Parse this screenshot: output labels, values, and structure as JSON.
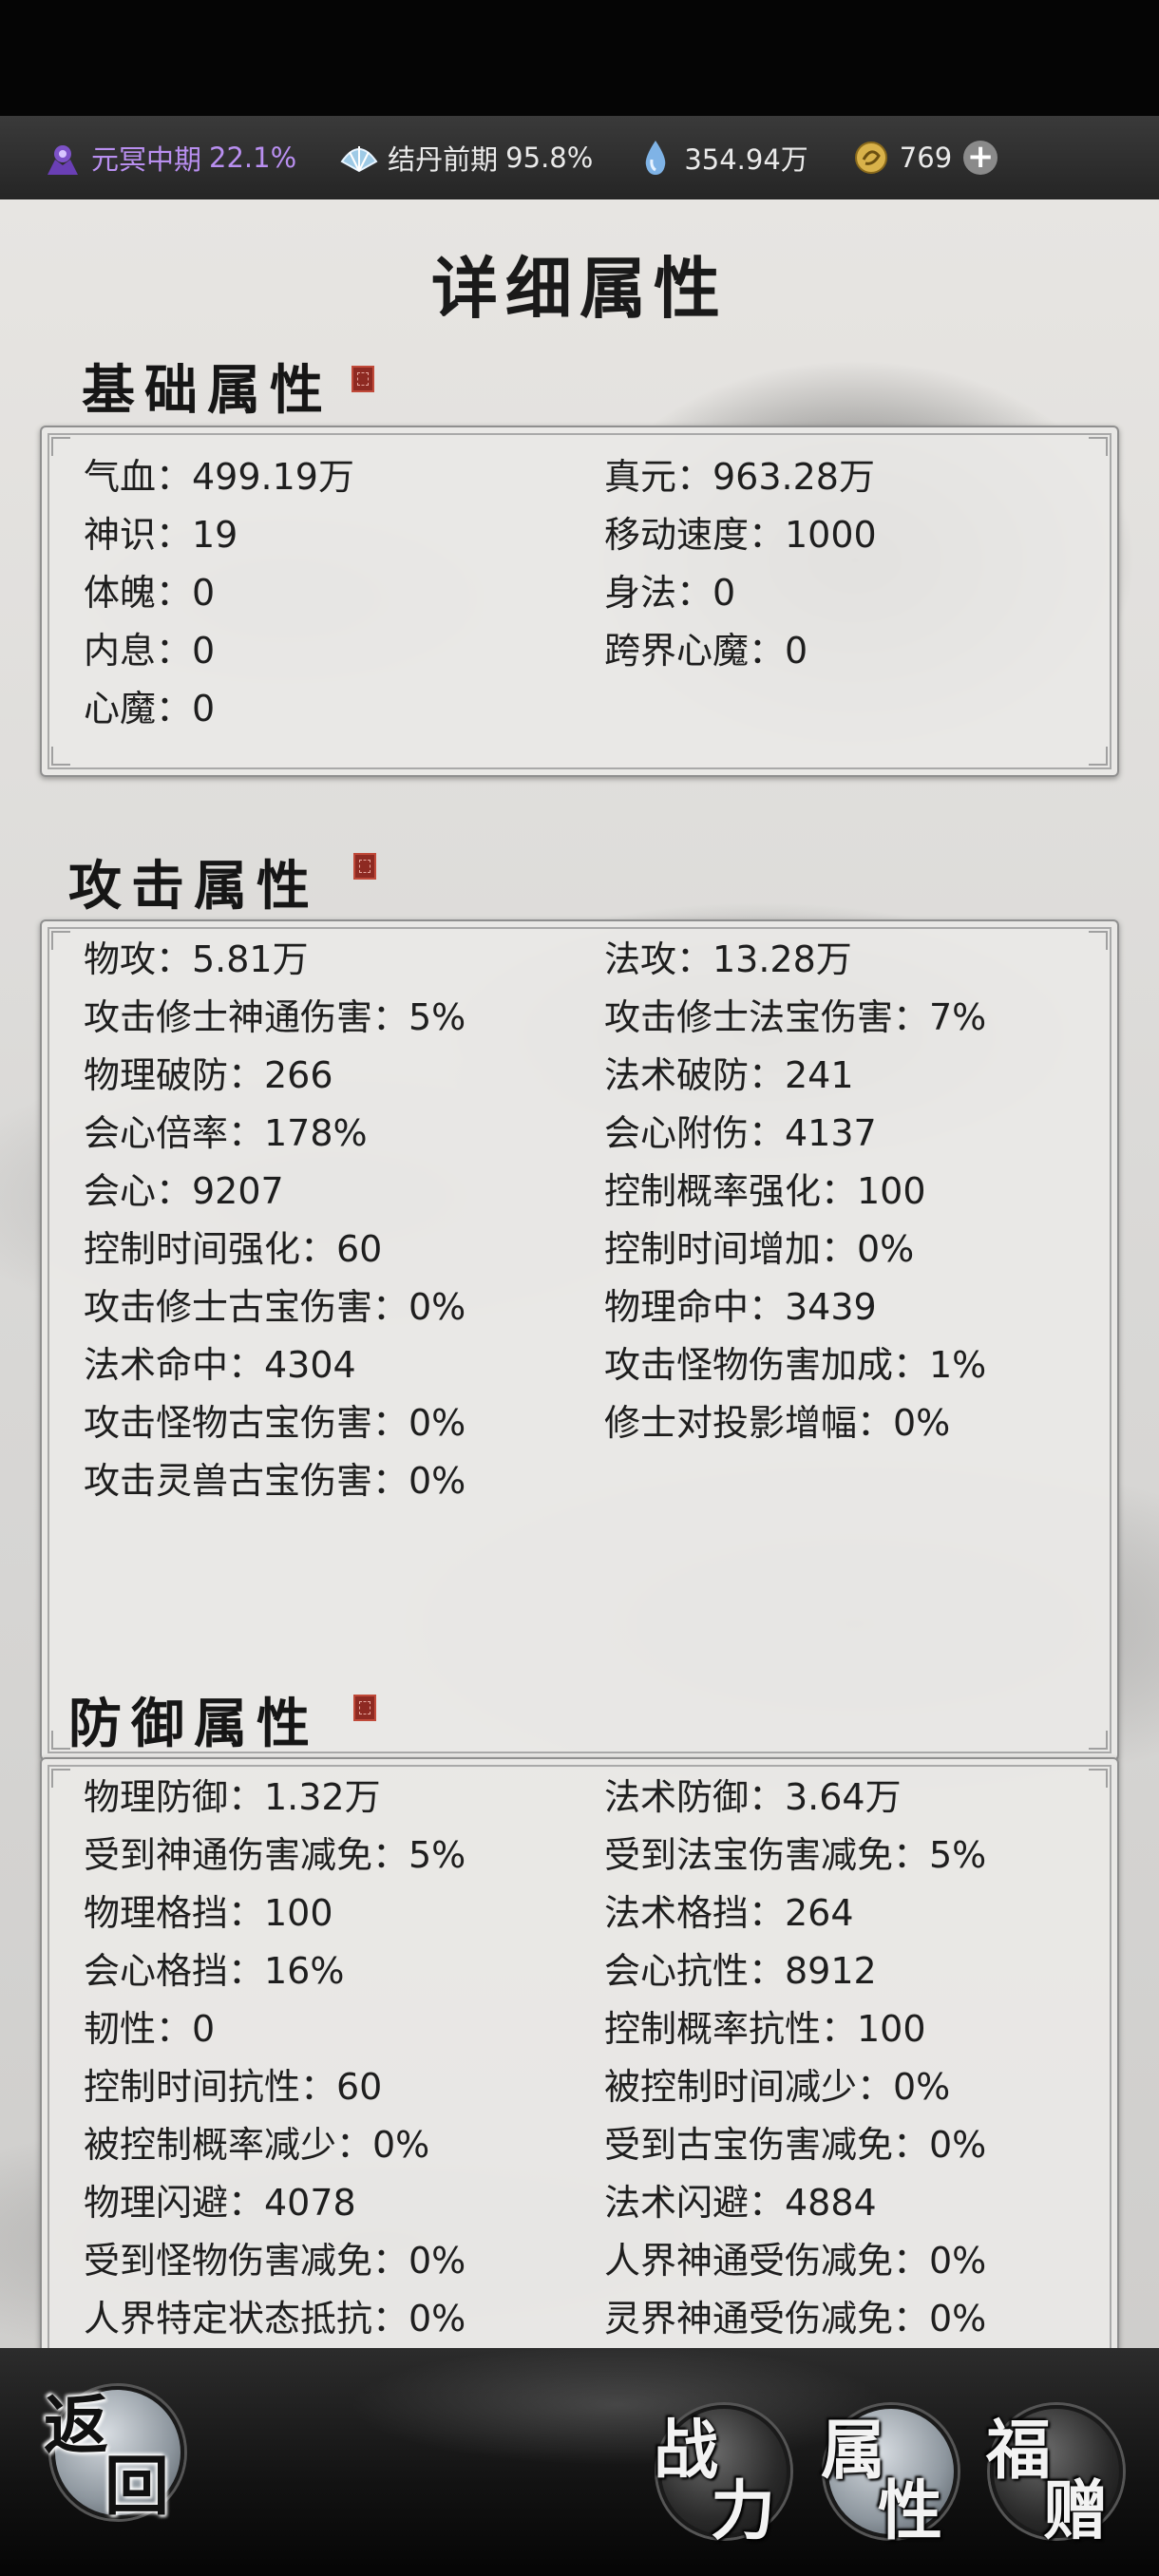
{
  "resources": {
    "realm": {
      "name": "元冥中期",
      "percent": "22.1%",
      "icon": "demon-realm-icon"
    },
    "core": {
      "name": "结丹前期",
      "percent": "95.8%",
      "icon": "fan-icon"
    },
    "spirit_water": {
      "amount": "354.94万",
      "icon": "water-drop-icon"
    },
    "coins": {
      "amount": "769",
      "icon": "coin-icon"
    },
    "add_label": "+"
  },
  "page_title": "详细属性",
  "sections": {
    "basic": {
      "title": "基础属性",
      "rows": [
        [
          "气血：499.19万",
          "真元：963.28万"
        ],
        [
          "神识：19",
          "移动速度：1000"
        ],
        [
          "体魄：0",
          "身法：0"
        ],
        [
          "内息：0",
          "跨界心魔：0"
        ],
        [
          "心魔：0",
          ""
        ]
      ]
    },
    "attack": {
      "title": "攻击属性",
      "rows": [
        [
          "物攻：5.81万",
          "法攻：13.28万"
        ],
        [
          "攻击修士神通伤害：5%",
          "攻击修士法宝伤害：7%"
        ],
        [
          "物理破防：266",
          "法术破防：241"
        ],
        [
          "会心倍率：178%",
          "会心附伤：4137"
        ],
        [
          "会心：9207",
          "控制概率强化：100"
        ],
        [
          "控制时间强化：60",
          "控制时间增加：0%"
        ],
        [
          "攻击修士古宝伤害：0%",
          "物理命中：3439"
        ],
        [
          "法术命中：4304",
          "攻击怪物伤害加成：1%"
        ],
        [
          "攻击怪物古宝伤害：0%",
          "修士对投影增幅：0%"
        ],
        [
          "攻击灵兽古宝伤害：0%",
          ""
        ]
      ]
    },
    "defense": {
      "title": "防御属性",
      "rows": [
        [
          "物理防御：1.32万",
          "法术防御：3.64万"
        ],
        [
          "受到神通伤害减免：5%",
          "受到法宝伤害减免：5%"
        ],
        [
          "物理格挡：100",
          "法术格挡：264"
        ],
        [
          "会心格挡：16%",
          "会心抗性：8912"
        ],
        [
          "韧性：0",
          "控制概率抗性：100"
        ],
        [
          "控制时间抗性：60",
          "被控制时间减少：0%"
        ],
        [
          "被控制概率减少：0%",
          "受到古宝伤害减免：0%"
        ],
        [
          "物理闪避：4078",
          "法术闪避：4884"
        ],
        [
          "受到怪物伤害减免：0%",
          "人界神通受伤减免：0%"
        ],
        [
          "人界特定状态抵抗：0%",
          "灵界神通受伤减免：0%"
        ]
      ]
    }
  },
  "nav": {
    "back": {
      "chars": [
        "返",
        "回"
      ]
    },
    "power": {
      "chars": [
        "战",
        "力"
      ]
    },
    "attributes": {
      "chars": [
        "属",
        "性"
      ]
    },
    "gift": {
      "chars": [
        "福",
        "赠"
      ]
    }
  }
}
